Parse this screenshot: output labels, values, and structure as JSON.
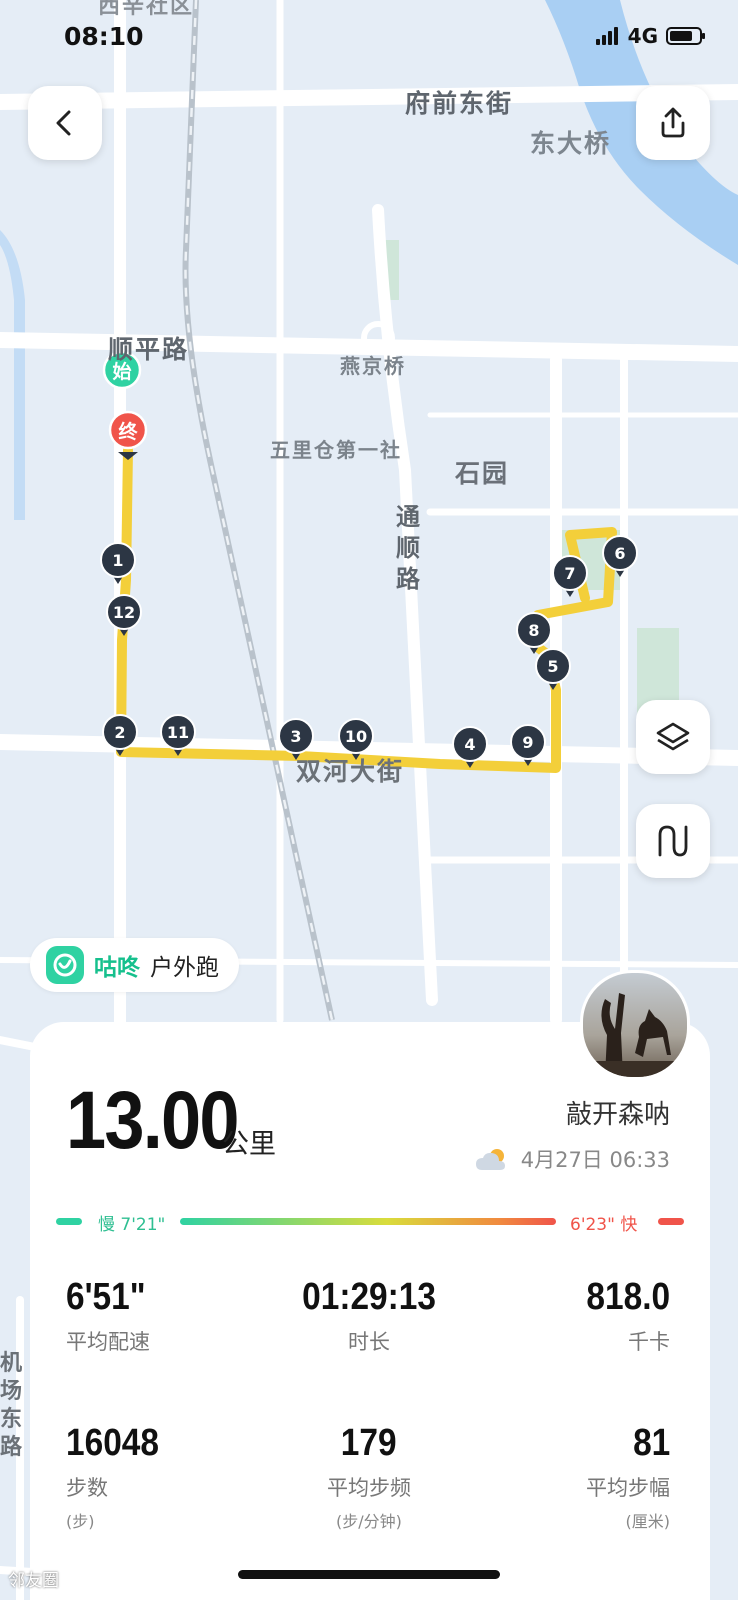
{
  "status_bar": {
    "time": "08:10",
    "network": "4G"
  },
  "map_labels": {
    "fuqian": "府前东街",
    "dongdaqiao": "东大桥",
    "shunping": "顺平路",
    "yanjing": "燕京桥",
    "wuli": "五里仓第一社",
    "shiyuan": "石园",
    "tongshun": "通顺路",
    "shuanghe": "双河大街",
    "xixin": "西辛社区",
    "jichang": "机场东路"
  },
  "markers": {
    "start": "始",
    "end": "终",
    "km": [
      "1",
      "2",
      "3",
      "4",
      "5",
      "6",
      "7",
      "8",
      "9",
      "10",
      "11",
      "12"
    ]
  },
  "badge": {
    "brand": "咕咚",
    "type": "户外跑"
  },
  "summary": {
    "distance": "13.00",
    "unit": "公里",
    "username": "敲开森呐",
    "date": "4月27日 06:33"
  },
  "pace_legend": {
    "slow": "慢 7'21\"",
    "fast": "6'23\" 快",
    "slow_color": "#2fd2a2",
    "fast_color": "#f0544a"
  },
  "stats": [
    {
      "value": "6'51\"",
      "label": "平均配速",
      "sub": ""
    },
    {
      "value": "01:29:13",
      "label": "时长",
      "sub": ""
    },
    {
      "value": "818.0",
      "label": "千卡",
      "sub": ""
    },
    {
      "value": "16048",
      "label": "步数",
      "sub": "(步)"
    },
    {
      "value": "179",
      "label": "平均步频",
      "sub": "(步/分钟)"
    },
    {
      "value": "81",
      "label": "平均步幅",
      "sub": "(厘米)"
    }
  ],
  "watermark": "邻友圈",
  "colors": {
    "route": "#f3cf3a",
    "accent": "#2fd2a2",
    "marker": "#2c3644"
  },
  "icons": {
    "back": "chevron-left-icon",
    "share": "share-icon",
    "layers": "layers-icon",
    "track": "track-icon",
    "weather": "partly-cloudy-icon"
  }
}
